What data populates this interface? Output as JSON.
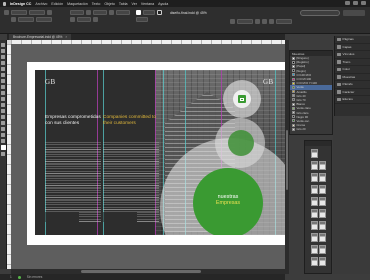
{
  "menubar": {
    "app_name": "InDesign CC",
    "items": [
      "Archivo",
      "Edición",
      "Maquetación",
      "Texto",
      "Objeto",
      "Tabla",
      "Ver",
      "Ventana",
      "Ayuda"
    ]
  },
  "controlbar": {
    "doc_title": "diseño-final.indd @ 45%"
  },
  "tab": {
    "label": "Brochure-Empresarial.indd @ 45%",
    "close": "×"
  },
  "document": {
    "logo_left": "GB",
    "logo_right": "GB",
    "heading_white": "Empresas comprometidas con sus clientes",
    "heading_yellow": "Companies committed to their customers",
    "circle_line1": "nuestras",
    "circle_line2": "Empresas",
    "colors": {
      "green": "#3a9a32",
      "yellow": "#e2b93b",
      "dark_panel": "#2d2d2d"
    }
  },
  "swatches": {
    "tab_label": "Muestras",
    "rows": [
      {
        "name": "[Ninguno]",
        "color": "#ffffff"
      },
      {
        "name": "[Registro]",
        "color": "#000000"
      },
      {
        "name": "[Papel]",
        "color": "#ffffff"
      },
      {
        "name": "[Negro]",
        "color": "#1a1a1a"
      },
      {
        "name": "C=100 M=0",
        "color": "#00a0e0"
      },
      {
        "name": "C=0 M=100",
        "color": "#e0007a"
      },
      {
        "name": "C=0 M=0 Y=100",
        "color": "#ffee00"
      },
      {
        "name": "Verde",
        "color": "#3a9a32"
      },
      {
        "name": "Amarillo",
        "color": "#e2b93b"
      },
      {
        "name": "Gris 40",
        "color": "#999999"
      },
      {
        "name": "Gris 70",
        "color": "#4d4d4d"
      },
      {
        "name": "Blanco",
        "color": "#f2f2f2"
      },
      {
        "name": "Verde claro",
        "color": "#7fc25a"
      },
      {
        "name": "Gris claro",
        "color": "#cccccc"
      },
      {
        "name": "Negro 90",
        "color": "#222222"
      },
      {
        "name": "Verde osc.",
        "color": "#2a6e24"
      },
      {
        "name": "Crema",
        "color": "#f3e7c2"
      },
      {
        "name": "Gris 20",
        "color": "#d6d6d6"
      }
    ]
  },
  "panels": {
    "items": [
      "Páginas",
      "Capas",
      "Vínculos",
      "Trazo",
      "Color",
      "Muestras",
      "Párrafo",
      "Carácter",
      "Efectos"
    ]
  },
  "status": {
    "page": "1",
    "preflight": "Sin errores"
  }
}
